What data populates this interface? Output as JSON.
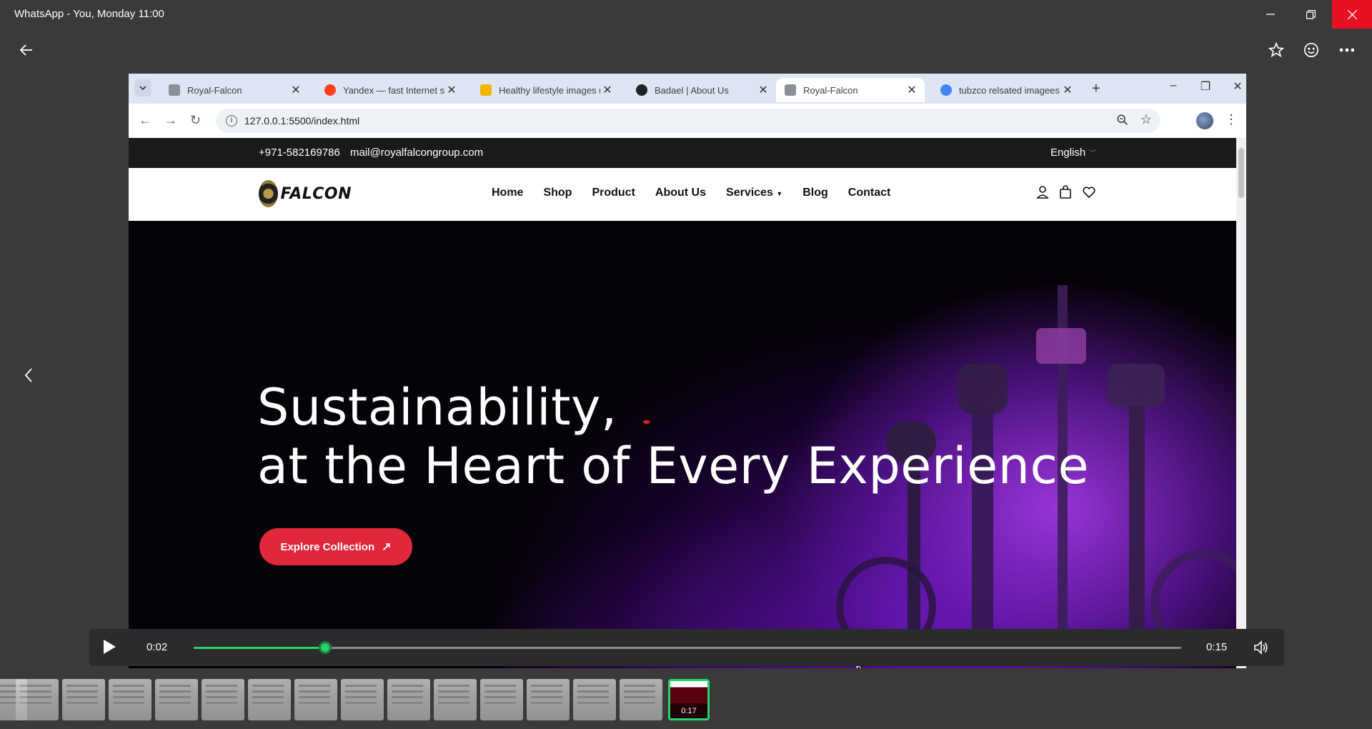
{
  "window": {
    "title": "WhatsApp - You, Monday 11:00"
  },
  "viewer": {
    "back_label": "Back",
    "prev_label": "Previous"
  },
  "browser": {
    "tabs": [
      {
        "label": "Royal-Falcon",
        "favicon_color": "#8a8f99",
        "active": false
      },
      {
        "label": "Yandex — fast Internet search",
        "favicon_color": "#fc3f1d",
        "active": false
      },
      {
        "label": "Healthy lifestyle images us",
        "favicon_color": "#f4b400",
        "active": false
      },
      {
        "label": "Badael | About Us",
        "favicon_color": "#222222",
        "active": false
      },
      {
        "label": "Royal-Falcon",
        "favicon_color": "#8a8f99",
        "active": true
      },
      {
        "label": "tubzco relsated imagees fo",
        "favicon_color": "#4285f4",
        "active": false
      }
    ],
    "url": "127.0.0.1:5500/index.html"
  },
  "site": {
    "phone": "+971-582169786",
    "email": "mail@royalfalcongroup.com",
    "language": "English",
    "logo_text": "FALCON",
    "nav": [
      "Home",
      "Shop",
      "Product",
      "About Us",
      "Services",
      "Blog",
      "Contact"
    ],
    "hero_line1": "Sustainability,",
    "hero_line2": "at the Heart of Every Experience",
    "cta_label": "Explore Collection",
    "accent_color": "#e0283a"
  },
  "player": {
    "current_time": "0:02",
    "total_time": "0:15",
    "progress": 0.1333,
    "accent_color": "#25d366"
  },
  "thumbnails": {
    "selected_duration": "0:17"
  }
}
